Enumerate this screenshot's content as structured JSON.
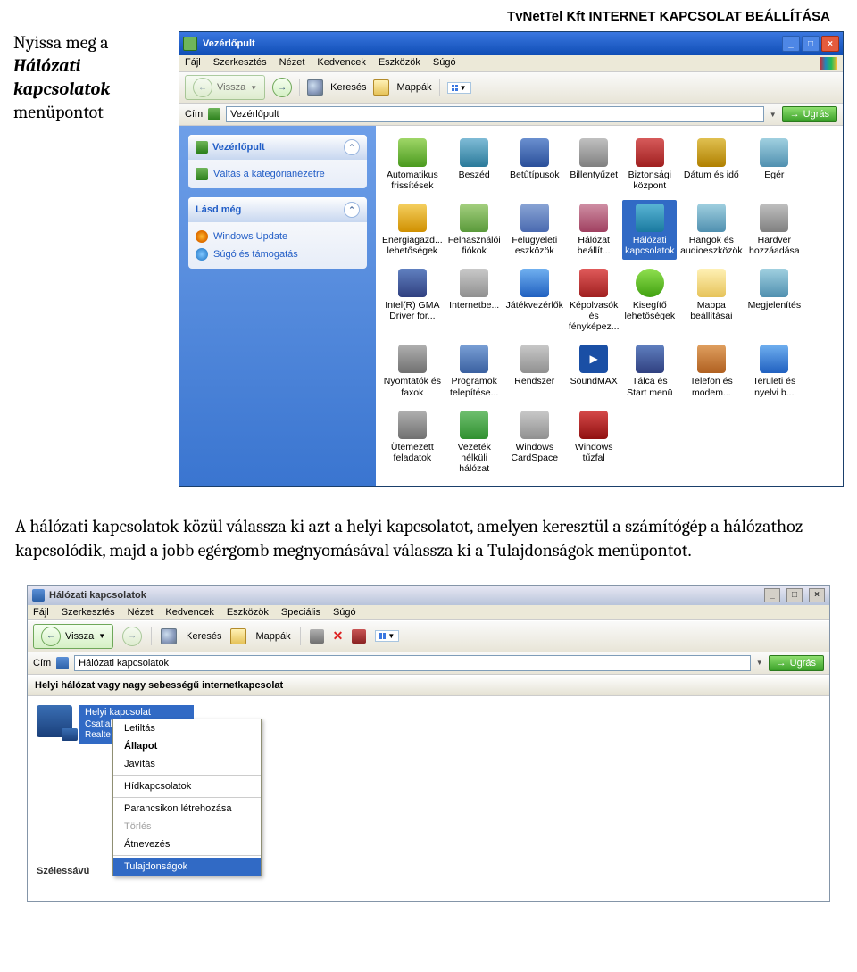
{
  "header": "TvNetTel Kft INTERNET KAPCSOLAT BEÁLLÍTÁSA",
  "side1": {
    "l1": "Nyissa meg a",
    "l2": "Hálózati",
    "l3": "kapcsolatok",
    "l4": "menüpontot"
  },
  "win1": {
    "title": "Vezérlőpult",
    "menus": [
      "Fájl",
      "Szerkesztés",
      "Nézet",
      "Kedvencek",
      "Eszközök",
      "Súgó"
    ],
    "back": "Vissza",
    "search": "Keresés",
    "folders": "Mappák",
    "addr_label": "Cím",
    "addr_value": "Vezérlőpult",
    "go": "Ugrás",
    "lp": {
      "head": "Vezérlőpult",
      "switch": "Váltás a kategórianézetre",
      "see": "Lásd még",
      "wu": "Windows Update",
      "help": "Súgó és támogatás"
    },
    "items": [
      {
        "l": "Automatikus frissítések",
        "c": "c0"
      },
      {
        "l": "Beszéd",
        "c": "c1"
      },
      {
        "l": "Betűtípusok",
        "c": "c2"
      },
      {
        "l": "Billentyűzet",
        "c": "c3"
      },
      {
        "l": "Biztonsági központ",
        "c": "c4"
      },
      {
        "l": "Dátum és idő",
        "c": "c5"
      },
      {
        "l": "Egér",
        "c": "c6"
      },
      {
        "l": "",
        "c": ""
      },
      {
        "l": "Energiagazd... lehetőségek",
        "c": "c7"
      },
      {
        "l": "Felhasználói fiókok",
        "c": "c8"
      },
      {
        "l": "Felügyeleti eszközök",
        "c": "c9"
      },
      {
        "l": "Hálózat beállít...",
        "c": "c10"
      },
      {
        "l": "Hálózati kapcsolatok",
        "c": "c11",
        "sel": true
      },
      {
        "l": "Hangok és audioeszközök",
        "c": "c6"
      },
      {
        "l": "Hardver hozzáadása",
        "c": "c3"
      },
      {
        "l": "",
        "c": ""
      },
      {
        "l": "Intel(R) GMA Driver for...",
        "c": "c14"
      },
      {
        "l": "Internetbe...",
        "c": "c15"
      },
      {
        "l": "Játékvezérlők",
        "c": "c16"
      },
      {
        "l": "Képolvasók és fényképez...",
        "c": "c17"
      },
      {
        "l": "Kisegítő lehetőségek",
        "c": "c12"
      },
      {
        "l": "Mappa beállításai",
        "c": "c13"
      },
      {
        "l": "Megjelenítés",
        "c": "c6"
      },
      {
        "l": "",
        "c": ""
      },
      {
        "l": "Nyomtatók és faxok",
        "c": "c19"
      },
      {
        "l": "Programok telepítése...",
        "c": "c20"
      },
      {
        "l": "Rendszer",
        "c": "c15"
      },
      {
        "l": "SoundMAX",
        "c": "c18"
      },
      {
        "l": "Tálca és Start menü",
        "c": "c14"
      },
      {
        "l": "Telefon és modem...",
        "c": "c21"
      },
      {
        "l": "Területi és nyelvi b...",
        "c": "c16"
      },
      {
        "l": "",
        "c": ""
      },
      {
        "l": "Ütemezett feladatok",
        "c": "c22"
      },
      {
        "l": "Vezeték nélküli hálózat",
        "c": "c23"
      },
      {
        "l": "Windows CardSpace",
        "c": "c15"
      },
      {
        "l": "Windows tűzfal",
        "c": "c24"
      }
    ]
  },
  "para": {
    "p1": "A hálózati kapcsolatok közül válassza ki azt a helyi kapcsolatot, amelyen keresztül a számítógép a hálózathoz kapcsolódik, majd a jobb egérgomb megnyomásával válassza ki a ",
    "em": "Tulajdonságok",
    "p2": " menüpontot."
  },
  "win2": {
    "title": "Hálózati kapcsolatok",
    "menus": [
      "Fájl",
      "Szerkesztés",
      "Nézet",
      "Kedvencek",
      "Eszközök",
      "Speciális",
      "Súgó"
    ],
    "back": "Vissza",
    "search": "Keresés",
    "folders": "Mappák",
    "addr_label": "Cím",
    "addr_value": "Hálózati kapcsolatok",
    "go": "Ugrás",
    "section": "Helyi hálózat vagy nagy sebességű internetkapcsolat",
    "conn": {
      "name": "Helyi kapcsolat",
      "status": "Csatlakoztatva, tűzfal védi",
      "dev": "Realte"
    },
    "wide": "Szélessávú",
    "ctx": [
      {
        "t": "Letiltás"
      },
      {
        "t": "Állapot",
        "bold": true
      },
      {
        "t": "Javítás"
      },
      {
        "sep": true
      },
      {
        "t": "Hídkapcsolatok"
      },
      {
        "sep": true
      },
      {
        "t": "Parancsikon létrehozása"
      },
      {
        "t": "Törlés",
        "dis": true
      },
      {
        "t": "Átnevezés"
      },
      {
        "sep": true
      },
      {
        "t": "Tulajdonságok",
        "sel": true
      }
    ]
  }
}
